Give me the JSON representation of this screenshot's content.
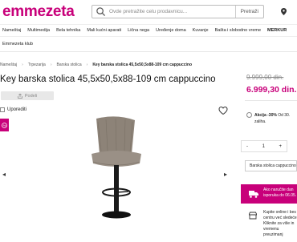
{
  "header": {
    "logo": "emmezeta",
    "search_placeholder": "Ovde pretražite celu prodavnicu...",
    "search_button": "Pretraži"
  },
  "nav": {
    "items": [
      "Nameštaj",
      "Multimedija",
      "Bela tehnika",
      "Mali kućni aparati",
      "Lična nega",
      "Uređenje doma",
      "Kuvanje",
      "Bašta i slobodno vreme",
      "MERKUR"
    ],
    "klub": "Emmezeta klub"
  },
  "breadcrumb": [
    "Nameštaj",
    "Trpezarija",
    "Barska stolica",
    "Key barska stolica 45,5x50,5x88-109 cm cappuccino"
  ],
  "product": {
    "title": "Key barska stolica 45,5x50,5x88-109 cm cappuccino",
    "share_label": "Podeli",
    "compare_label": "Uporediti"
  },
  "pricing": {
    "old_price": "9.999,00 din.",
    "new_price": "6.999,30 din.",
    "promo_bold": "Akcija -30%",
    "promo_rest": "Od 30.",
    "promo_line2": "zaliha.",
    "quantity": "1",
    "qty_minus": "-",
    "qty_plus": "+",
    "variant": "Barska stolica cappuccino",
    "cart_line1": "Ako naručite dan",
    "cart_line2": "isporuka do 06.05.",
    "pickup_line1": "Kupite online i bes",
    "pickup_line2": "centru već sledeće",
    "pickup_line3": "Kliknite za više in",
    "pickup_line4": "vremenu preuzimanj"
  },
  "colors": {
    "brand": "#c8007a"
  }
}
